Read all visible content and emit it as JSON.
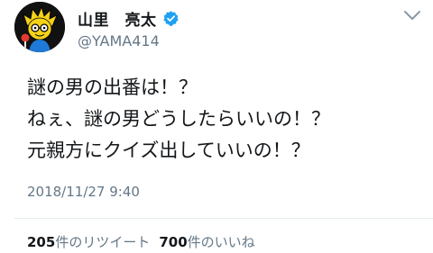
{
  "profile": {
    "display_name": "山里　亮太",
    "handle": "@YAMA414",
    "verified": true,
    "avatar_icon": "cartoon-avatar-icon",
    "verified_icon": "verified-badge-icon",
    "menu_icon": "chevron-down-icon",
    "colors": {
      "verified": "#1da1f2",
      "muted": "#657786",
      "text": "#14171a"
    }
  },
  "tweet": {
    "lines": [
      "謎の男の出番は！？",
      "ねぇ、謎の男どうしたらいいの！？",
      "元親方にクイズ出していいの！？"
    ],
    "timestamp": "2018/11/27 9:40"
  },
  "stats": {
    "retweets_count": "205",
    "retweets_label": "件のリツイート",
    "likes_count": "700",
    "likes_label": "件のいいね"
  }
}
